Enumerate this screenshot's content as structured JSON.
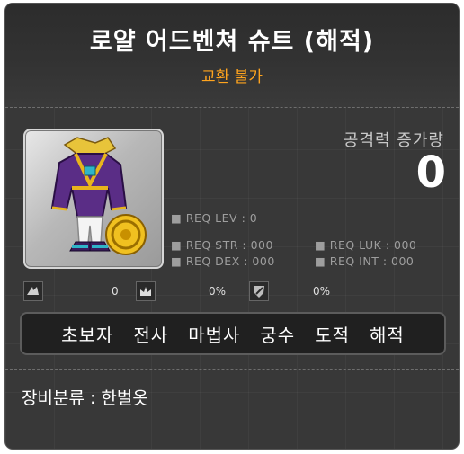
{
  "item": {
    "name": "로얄 어드벤쳐 슈트 (해적)",
    "trade_status": "교환 불가",
    "stat_label": "공격력 증가량",
    "stat_value": "0"
  },
  "requirements": {
    "level": "■ REQ LEV :   0",
    "str": "■ REQ STR : 000",
    "luk": "■ REQ LUK : 000",
    "dex": "■ REQ DEX : 000",
    "int": "■ REQ INT : 000"
  },
  "properties": [
    {
      "icon": "wing-icon",
      "value": "0"
    },
    {
      "icon": "crown-icon",
      "value": "0%"
    },
    {
      "icon": "shield-icon",
      "value": "0%"
    }
  ],
  "jobs": [
    "초보자",
    "전사",
    "마법사",
    "궁수",
    "도적",
    "해적"
  ],
  "category": "장비분류 : 한벌옷",
  "colors": {
    "background": "#383838",
    "title": "#ffffff",
    "trade_status": "#ffa41e",
    "requirement_text": "#9e9e9e",
    "outfit_purple": "#5a2d86",
    "outfit_gold": "#e8b41c"
  }
}
